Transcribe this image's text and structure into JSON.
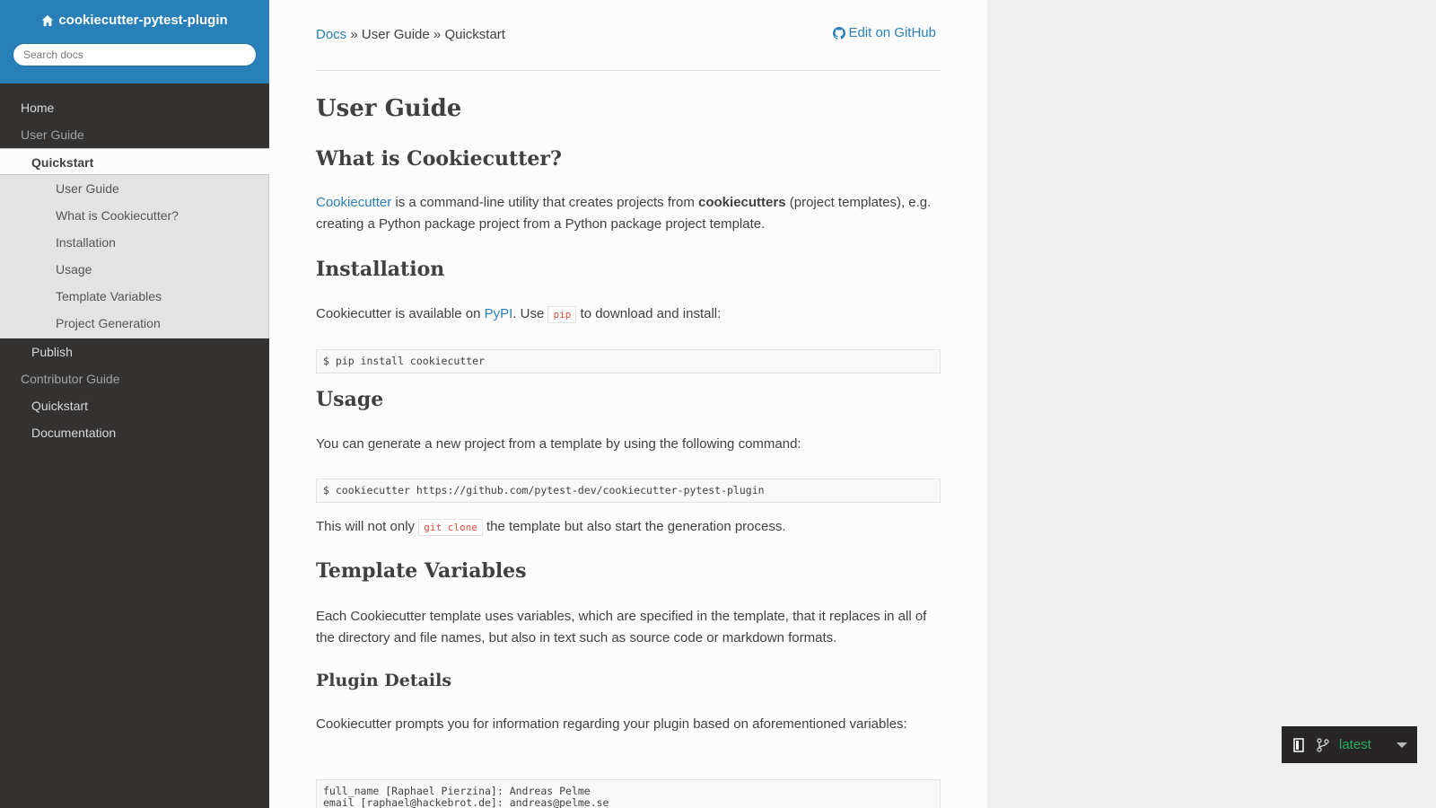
{
  "sidebar": {
    "project_name": "cookiecutter-pytest-plugin",
    "search_placeholder": "Search docs",
    "nav": {
      "home": "Home",
      "user_guide": "User Guide",
      "quickstart_current": "Quickstart",
      "toc": [
        "User Guide",
        "What is Cookiecutter?",
        "Installation",
        "Usage",
        "Template Variables",
        "Project Generation"
      ],
      "publish": "Publish",
      "contributor_guide": "Contributor Guide",
      "contrib_quickstart": "Quickstart",
      "documentation": "Documentation"
    }
  },
  "breadcrumbs": {
    "docs": "Docs",
    "sep1": " » ",
    "user_guide": "User Guide",
    "sep2": " » ",
    "current": "Quickstart",
    "edit": "Edit on GitHub"
  },
  "content": {
    "title": "User Guide",
    "s1_heading": "What is Cookiecutter?",
    "s1_link": "Cookiecutter",
    "s1_text1": " is a command-line utility that creates projects from ",
    "s1_bold": "cookiecutters",
    "s1_text2": " (project templates), e.g. creating a Python package project from a Python package project template.",
    "s2_heading": "Installation",
    "s2_text1": "Cookiecutter is available on ",
    "s2_link": "PyPI",
    "s2_text2": ". Use ",
    "s2_code": "pip",
    "s2_text3": " to download and install:",
    "s2_block": "$ pip install cookiecutter",
    "s3_heading": "Usage",
    "s3_text": "You can generate a new project from a template by using the following command:",
    "s3_block": "$ cookiecutter https://github.com/pytest-dev/cookiecutter-pytest-plugin",
    "s3_text2a": "This will not only ",
    "s3_code": "git clone",
    "s3_text2b": " the template but also start the generation process.",
    "s4_heading": "Template Variables",
    "s4_text": "Each Cookiecutter template uses variables, which are specified in the template, that it replaces in all of the directory and file names, but also in text such as source code or markdown formats.",
    "s5_heading": "Plugin Details",
    "s5_text": "Cookiecutter prompts you for information regarding your plugin based on aforementioned variables:",
    "s5_block_line1": "full_name [Raphael Pierzina]: Andreas Pelme",
    "s5_block_line2": "email [raphael@hackebrot.de]: andreas@pelme.se"
  },
  "version_badge": {
    "version": "latest",
    "book_icon": "book-icon",
    "branch_icon": "git-branch-icon",
    "caret_icon": "caret-down-icon"
  },
  "colors": {
    "sidebar_top": "#2980b9",
    "sidebar_bg": "#343131",
    "link": "#2980b9",
    "badge_text": "#27ae60",
    "code_text": "#e74c3c"
  }
}
